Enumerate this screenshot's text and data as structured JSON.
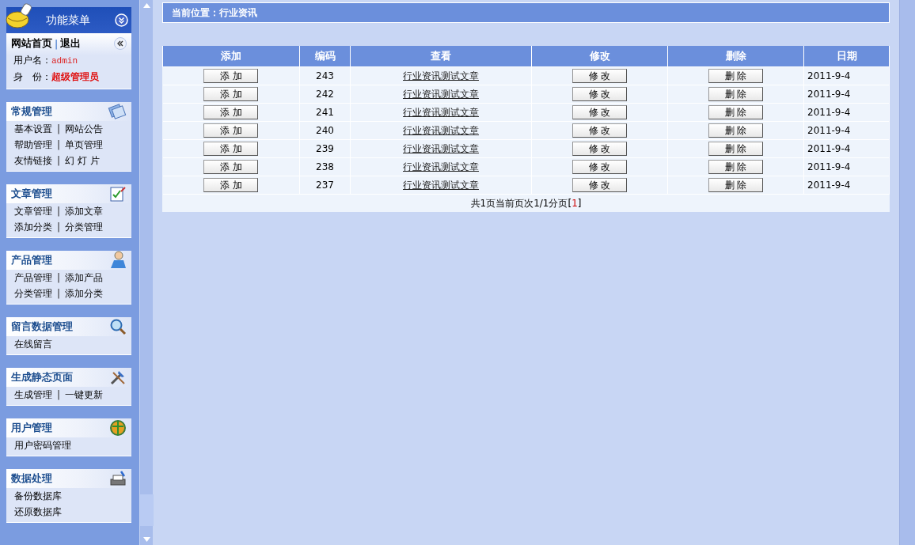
{
  "sidebar": {
    "header": {
      "title": "功能菜单"
    },
    "account": {
      "links": [
        "网站首页",
        "退出"
      ],
      "fields": [
        {
          "label": "用户名：",
          "value": "admin",
          "kind": "mono"
        },
        {
          "label": "身　份：",
          "value": "超级管理员",
          "kind": "bold"
        }
      ]
    },
    "separator": "|",
    "sections": [
      {
        "title": "常规管理",
        "kind": "general",
        "rows": [
          [
            "基本设置",
            "网站公告"
          ],
          [
            "帮助管理",
            "单页管理"
          ],
          [
            "友情链接",
            "幻 灯 片"
          ]
        ]
      },
      {
        "title": "文章管理",
        "kind": "article",
        "rows": [
          [
            "文章管理",
            "添加文章"
          ],
          [
            "添加分类",
            "分类管理"
          ]
        ]
      },
      {
        "title": "产品管理",
        "kind": "product",
        "rows": [
          [
            "产品管理",
            "添加产品"
          ],
          [
            "分类管理",
            "添加分类"
          ]
        ]
      },
      {
        "title": "留言数据管理",
        "kind": "message",
        "rows": [
          [
            "在线留言"
          ]
        ]
      },
      {
        "title": "生成静态页面",
        "kind": "static",
        "rows": [
          [
            "生成管理",
            "一键更新"
          ]
        ]
      },
      {
        "title": "用户管理",
        "kind": "user",
        "rows": [
          [
            "用户密码管理"
          ]
        ]
      },
      {
        "title": "数据处理",
        "kind": "data",
        "rows": [
          [
            "备份数据库"
          ],
          [
            "还原数据库"
          ]
        ]
      }
    ]
  },
  "breadcrumb": "当前位置：行业资讯",
  "table": {
    "columns": [
      "添加",
      "编码",
      "查看",
      "修改",
      "删除",
      "日期"
    ],
    "rows": [
      {
        "add": "添 加",
        "id": "243",
        "title": "行业资讯测试文章",
        "edit": "修 改",
        "delete": "删 除",
        "date": "2011-9-4"
      },
      {
        "add": "添 加",
        "id": "242",
        "title": "行业资讯测试文章",
        "edit": "修 改",
        "delete": "删 除",
        "date": "2011-9-4"
      },
      {
        "add": "添 加",
        "id": "241",
        "title": "行业资讯测试文章",
        "edit": "修 改",
        "delete": "删 除",
        "date": "2011-9-4"
      },
      {
        "add": "添 加",
        "id": "240",
        "title": "行业资讯测试文章",
        "edit": "修 改",
        "delete": "删 除",
        "date": "2011-9-4"
      },
      {
        "add": "添 加",
        "id": "239",
        "title": "行业资讯测试文章",
        "edit": "修 改",
        "delete": "删 除",
        "date": "2011-9-4"
      },
      {
        "add": "添 加",
        "id": "238",
        "title": "行业资讯测试文章",
        "edit": "修 改",
        "delete": "删 除",
        "date": "2011-9-4"
      },
      {
        "add": "添 加",
        "id": "237",
        "title": "行业资讯测试文章",
        "edit": "修 改",
        "delete": "删 除",
        "date": "2011-9-4"
      }
    ],
    "pagination": {
      "prefix": "共1页当前页次1/1分页[",
      "pages": [
        {
          "label": "1",
          "selected": true
        }
      ],
      "suffix": "]"
    }
  }
}
